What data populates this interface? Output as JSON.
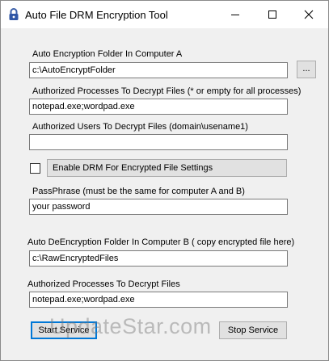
{
  "window": {
    "title": "Auto File DRM Encryption Tool",
    "app_icon": "lock-icon",
    "controls": {
      "minimize": "minimize-icon",
      "maximize": "maximize-icon",
      "close": "close-icon"
    }
  },
  "form": {
    "encrypt_folder_label": "Auto Encryption Folder In Computer A",
    "encrypt_folder_value": "c:\\AutoEncryptFolder",
    "browse_label": "...",
    "processes_label": "Authorized Processes To Decrypt Files (* or empty for all processes)",
    "processes_value": "notepad.exe;wordpad.exe",
    "users_label": "Authorized Users To Decrypt Files  (domain\\usename1)",
    "users_value": "",
    "enable_drm_checked": false,
    "enable_drm_label": "Enable DRM For Encrypted File Settings",
    "passphrase_label": "PassPhrase (must be the same for computer A and B)",
    "passphrase_value": "your password",
    "decrypt_folder_label": "Auto DeEncryption Folder In Computer B ( copy encrypted file here)",
    "decrypt_folder_value": "c:\\RawEncryptedFiles",
    "decrypt_processes_label": "Authorized Processes To Decrypt Files",
    "decrypt_processes_value": "notepad.exe;wordpad.exe"
  },
  "buttons": {
    "start": "Start Service",
    "stop": "Stop Service"
  },
  "watermark": "UpdateStar.com",
  "colors": {
    "focus_border": "#0078d7",
    "button_face": "#e1e1e1",
    "window_bg": "#f0f0f0"
  }
}
